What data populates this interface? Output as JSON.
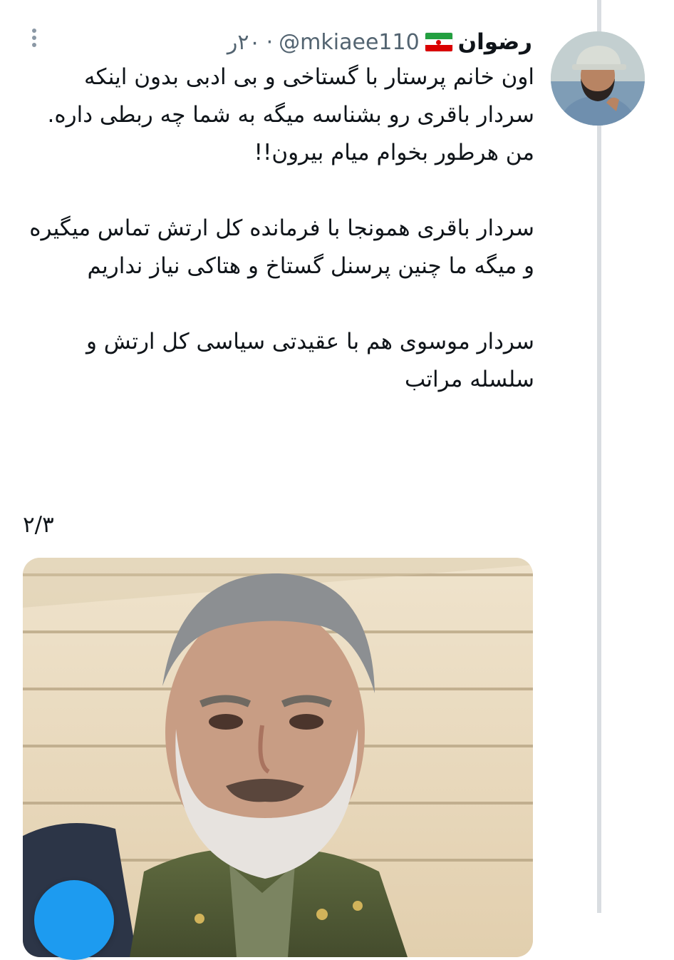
{
  "tweet": {
    "display_name": "رضوان",
    "handle": "@mkiaee110",
    "separator": "·",
    "time": "۲۰ر",
    "paragraphs": [
      "اون خانم پرستار با گستاخی و بی ادبی بدون اینکه سردار باقری رو بشناسه میگه به شما چه ربطی داره.",
      "من هرطور بخوام میام بیرون!!",
      "سردار باقری همونجا با فرمانده کل ارتش تماس میگیره و میگه ما چنین پرسنل گستاخ و هتاکی نیاز نداریم",
      "سردار موسوی هم با عقیدتی سیاسی کل ارتش و سلسله مراتب"
    ],
    "thread_counter": "۲/۳"
  },
  "icons": {
    "more": "more-vertical-icon",
    "flag": "iran-flag-emoji",
    "fab": "compose-fab-icon"
  },
  "colors": {
    "text": "#0f1419",
    "secondary": "#536471",
    "accent": "#1d9bf0",
    "thread_line": "#d9dde1"
  }
}
